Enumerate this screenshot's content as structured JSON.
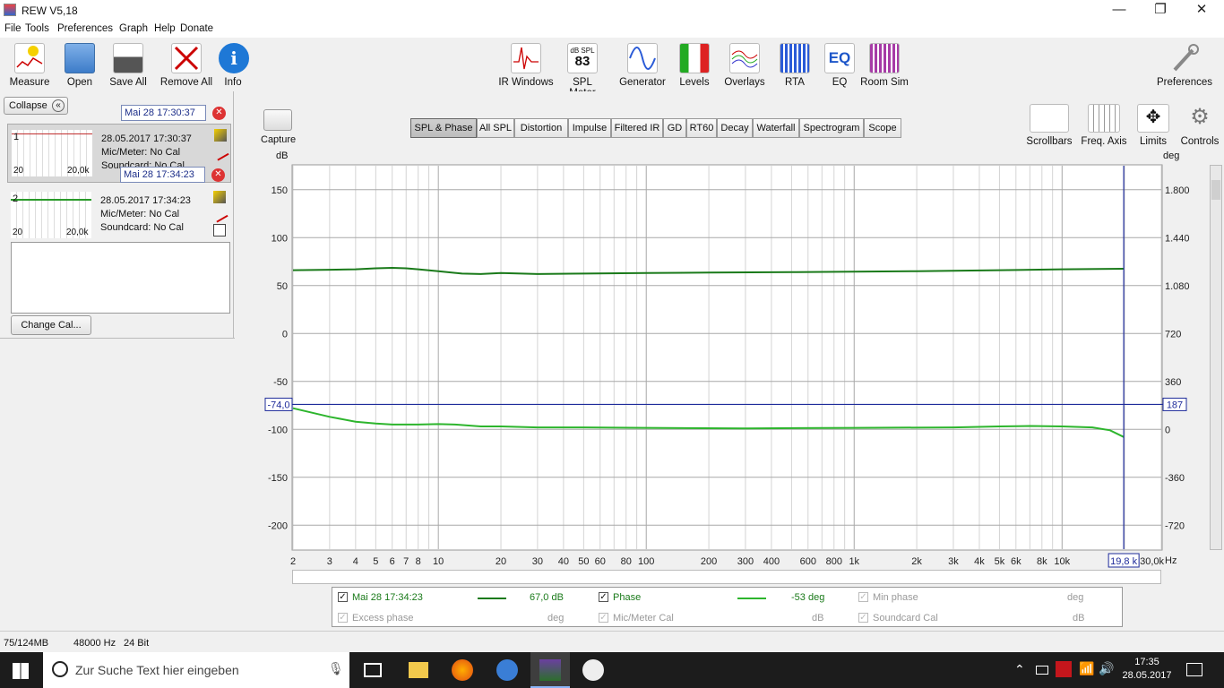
{
  "window": {
    "title": "REW V5,18",
    "minimize": "—",
    "maximize": "❐",
    "close": "✕"
  },
  "menu": [
    "File",
    "Tools",
    "Preferences",
    "Graph",
    "Help",
    "Donate"
  ],
  "toolbar_left": [
    {
      "label": "Measure",
      "icon": "measure-icon"
    },
    {
      "label": "Open",
      "icon": "folder-icon"
    },
    {
      "label": "Save All",
      "icon": "save-icon"
    },
    {
      "label": "Remove All",
      "icon": "remove-icon"
    },
    {
      "label": "Info",
      "icon": "info-icon"
    }
  ],
  "toolbar_center": [
    {
      "label": "IR Windows",
      "icon": "ir-windows-icon"
    },
    {
      "label": "SPL Meter",
      "icon": "spl-meter-icon",
      "ico_text_top": "dB SPL",
      "ico_text_big": "83"
    },
    {
      "label": "Generator",
      "icon": "generator-icon"
    },
    {
      "label": "Levels",
      "icon": "levels-icon"
    },
    {
      "label": "Overlays",
      "icon": "overlays-icon"
    },
    {
      "label": "RTA",
      "icon": "rta-icon"
    },
    {
      "label": "EQ",
      "icon": "eq-icon",
      "ico_text_big": "EQ"
    },
    {
      "label": "Room Sim",
      "icon": "room-sim-icon"
    }
  ],
  "preferences_label": "Preferences",
  "left": {
    "collapse_label": "Collapse",
    "change_cal_label": "Change Cal...",
    "measurements": [
      {
        "name": "Mai 28 17:30:37",
        "index": "1",
        "date": "28.05.2017 17:30:37",
        "mic": "Mic/Meter: No Cal",
        "sound": "Soundcard: No Cal",
        "xmin": "20",
        "xmax": "20,0k",
        "color": "#c03030"
      },
      {
        "name": "Mai 28 17:34:23",
        "index": "2",
        "date": "28.05.2017 17:34:23",
        "mic": "Mic/Meter: No Cal",
        "sound": "Soundcard: No Cal",
        "xmin": "20",
        "xmax": "20,0k",
        "color": "#2a9a2a"
      }
    ]
  },
  "capture_label": "Capture",
  "tabs": [
    "SPL & Phase",
    "All SPL",
    "Distortion",
    "Impulse",
    "Filtered IR",
    "GD",
    "RT60",
    "Decay",
    "Waterfall",
    "Spectrogram",
    "Scope"
  ],
  "active_tab": "SPL & Phase",
  "graph_tools": [
    {
      "label": "Scrollbars",
      "icon": "scrollbars-icon"
    },
    {
      "label": "Freq. Axis",
      "icon": "freq-axis-icon"
    },
    {
      "label": "Limits",
      "icon": "limits-icon"
    },
    {
      "label": "Controls",
      "icon": "gear-icon"
    }
  ],
  "cursor": {
    "y_readout": "-74,0",
    "phase_readout": "187",
    "x_readout": "19,8 k"
  },
  "chart_data": {
    "type": "line",
    "x_scale": "log",
    "xlim": [
      2,
      30000
    ],
    "ylim": [
      -225,
      175
    ],
    "y2lim": [
      -864,
      1944
    ],
    "ylabel": "dB",
    "y2label": "deg",
    "xunit": "Hz",
    "x_ticks": [
      {
        "v": 2,
        "l": "2"
      },
      {
        "v": 3,
        "l": "3"
      },
      {
        "v": 4,
        "l": "4"
      },
      {
        "v": 5,
        "l": "5"
      },
      {
        "v": 6,
        "l": "6"
      },
      {
        "v": 7,
        "l": "7"
      },
      {
        "v": 8,
        "l": "8"
      },
      {
        "v": 10,
        "l": "10"
      },
      {
        "v": 20,
        "l": "20"
      },
      {
        "v": 30,
        "l": "30"
      },
      {
        "v": 40,
        "l": "40"
      },
      {
        "v": 50,
        "l": "50"
      },
      {
        "v": 60,
        "l": "60"
      },
      {
        "v": 80,
        "l": "80"
      },
      {
        "v": 100,
        "l": "100"
      },
      {
        "v": 200,
        "l": "200"
      },
      {
        "v": 300,
        "l": "300"
      },
      {
        "v": 400,
        "l": "400"
      },
      {
        "v": 600,
        "l": "600"
      },
      {
        "v": 800,
        "l": "800"
      },
      {
        "v": 1000,
        "l": "1k"
      },
      {
        "v": 2000,
        "l": "2k"
      },
      {
        "v": 3000,
        "l": "3k"
      },
      {
        "v": 4000,
        "l": "4k"
      },
      {
        "v": 5000,
        "l": "5k"
      },
      {
        "v": 6000,
        "l": "6k"
      },
      {
        "v": 8000,
        "l": "8k"
      },
      {
        "v": 10000,
        "l": "10k"
      },
      {
        "v": 30000,
        "l": "30,0k"
      }
    ],
    "y_ticks": [
      150,
      100,
      50,
      0,
      -50,
      -100,
      -150,
      -200
    ],
    "y2_ticks": [
      "1.800",
      "1.440",
      "1.080",
      "720",
      "360",
      "0",
      "-360",
      "-720"
    ],
    "cursor_x": 19800,
    "cursor_y": -74,
    "series": [
      {
        "name": "Mai 28 17:34:23",
        "color": "#1a7a1a",
        "x": [
          2,
          3,
          4,
          5,
          6,
          7,
          8,
          10,
          13,
          16,
          20,
          30,
          50,
          100,
          200,
          500,
          1000,
          2000,
          5000,
          10000,
          19800
        ],
        "y": [
          66,
          66.5,
          67,
          68,
          68.5,
          68,
          67,
          65,
          62.5,
          62,
          63,
          62,
          62.5,
          63,
          63.5,
          64,
          64.5,
          65,
          66,
          67,
          67.5
        ]
      },
      {
        "name": "Phase",
        "color": "#2db52d",
        "x": [
          2,
          3,
          4,
          5,
          6,
          8,
          10,
          12,
          16,
          20,
          30,
          50,
          100,
          300,
          1000,
          3000,
          5000,
          7000,
          10000,
          14000,
          17000,
          19800
        ],
        "y": [
          -78,
          -87,
          -92,
          -94,
          -95,
          -95,
          -94.5,
          -95,
          -97,
          -97,
          -98,
          -98,
          -98.5,
          -99,
          -98.5,
          -98,
          -97,
          -96.5,
          -97,
          -98,
          -101,
          -108
        ]
      }
    ]
  },
  "legend": {
    "row1": [
      {
        "label": "Mai 28 17:34:23",
        "value": "67,0 dB",
        "color": "#1a7a1a",
        "checked": true
      },
      {
        "label": "Phase",
        "value": "-53 deg",
        "color": "#2db52d",
        "checked": true
      },
      {
        "label": "Min phase",
        "value": "deg",
        "checked": false
      }
    ],
    "row2": [
      {
        "label": "Excess phase",
        "value": "deg"
      },
      {
        "label": "Mic/Meter Cal",
        "value": "dB"
      },
      {
        "label": "Soundcard Cal",
        "value": "dB"
      }
    ]
  },
  "status": {
    "memory": "75/124MB",
    "rate": "48000 Hz",
    "bits": "24 Bit"
  },
  "taskbar": {
    "search_placeholder": "Zur Suche Text hier eingeben",
    "time": "17:35",
    "date": "28.05.2017"
  }
}
